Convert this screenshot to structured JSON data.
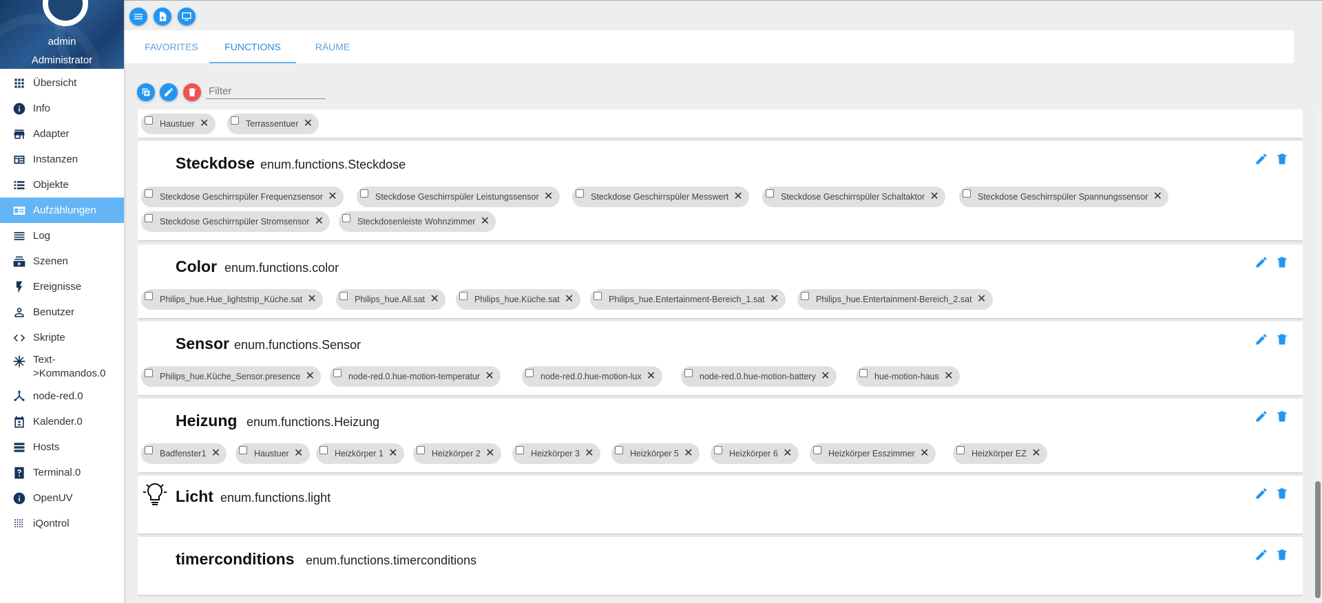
{
  "user": {
    "name": "admin",
    "role": "Administrator"
  },
  "nav": [
    {
      "label": "Übersicht",
      "icon": "apps-icon"
    },
    {
      "label": "Info",
      "icon": "info-icon"
    },
    {
      "label": "Adapter",
      "icon": "store-icon"
    },
    {
      "label": "Instanzen",
      "icon": "instances-icon"
    },
    {
      "label": "Objekte",
      "icon": "list-icon"
    },
    {
      "label": "Aufzählungen",
      "icon": "enum-icon",
      "active": true
    },
    {
      "label": "Log",
      "icon": "log-icon"
    },
    {
      "label": "Szenen",
      "icon": "scenes-icon"
    },
    {
      "label": "Ereignisse",
      "icon": "flash-icon"
    },
    {
      "label": "Benutzer",
      "icon": "person-icon"
    },
    {
      "label": "Skripte",
      "icon": "code-icon"
    },
    {
      "label": "Text->Kommandos.0",
      "icon": "snowflake-icon"
    },
    {
      "label": "node-red.0",
      "icon": "node-red-icon"
    },
    {
      "label": "Kalender.0",
      "icon": "calendar-icon"
    },
    {
      "label": "Hosts",
      "icon": "hosts-icon"
    },
    {
      "label": "Terminal.0",
      "icon": "terminal-icon"
    },
    {
      "label": "OpenUV",
      "icon": "openuv-icon"
    },
    {
      "label": "iQontrol",
      "icon": "iqontrol-icon"
    }
  ],
  "tabs": [
    {
      "label": "FAVORITES"
    },
    {
      "label": "FUNCTIONS",
      "active": true
    },
    {
      "label": "RÄUME"
    }
  ],
  "filter": {
    "placeholder": "Filter"
  },
  "cards": {
    "partial": {
      "chips": [
        "Haustuer",
        "Terrassentuer"
      ]
    },
    "steckdose": {
      "title": "Steckdose",
      "id": "enum.functions.Steckdose",
      "chips": [
        "Steckdose Geschirrspüler Frequenzsensor",
        "Steckdose Geschirrspüler Leistungssensor",
        "Steckdose Geschirrspüler Messwert",
        "Steckdose Geschirrspüler Schaltaktor",
        "Steckdose Geschirrspüler Spannungssensor",
        "Steckdose Geschirrspüler Stromsensor",
        "Steckdosenleiste Wohnzimmer"
      ]
    },
    "color": {
      "title": "Color",
      "id": "enum.functions.color",
      "chips": [
        "Philips_hue.Hue_lightstrip_Küche.sat",
        "Philips_hue.All.sat",
        "Philips_hue.Küche.sat",
        "Philips_hue.Entertainment-Bereich_1.sat",
        "Philips_hue.Entertainment-Bereich_2.sat"
      ]
    },
    "sensor": {
      "title": "Sensor",
      "id": "enum.functions.Sensor",
      "chips": [
        "Philips_hue.Küche_Sensor.presence",
        "node-red.0.hue-motion-temperatur",
        "node-red.0.hue-motion-lux",
        "node-red.0.hue-motion-battery",
        "hue-motion-haus"
      ]
    },
    "heizung": {
      "title": "Heizung",
      "id": "enum.functions.Heizung",
      "chips": [
        "Badfenster1",
        "Haustuer",
        "Heizkörper 1",
        "Heizkörper 2",
        "Heizkörper 3",
        "Heizkörper 5",
        "Heizkörper 6",
        "Heizkörper Esszimmer",
        "Heizkörper EZ"
      ]
    },
    "licht": {
      "title": "Licht",
      "id": "enum.functions.light",
      "icon": "lightbulb-icon"
    },
    "timer": {
      "title": "timerconditions",
      "id": "enum.functions.timerconditions"
    }
  },
  "colors": {
    "accent": "#2196f3",
    "active_nav": "#64b5f6",
    "delete": "#ef5350",
    "sidebar_header": "#1e4574"
  }
}
